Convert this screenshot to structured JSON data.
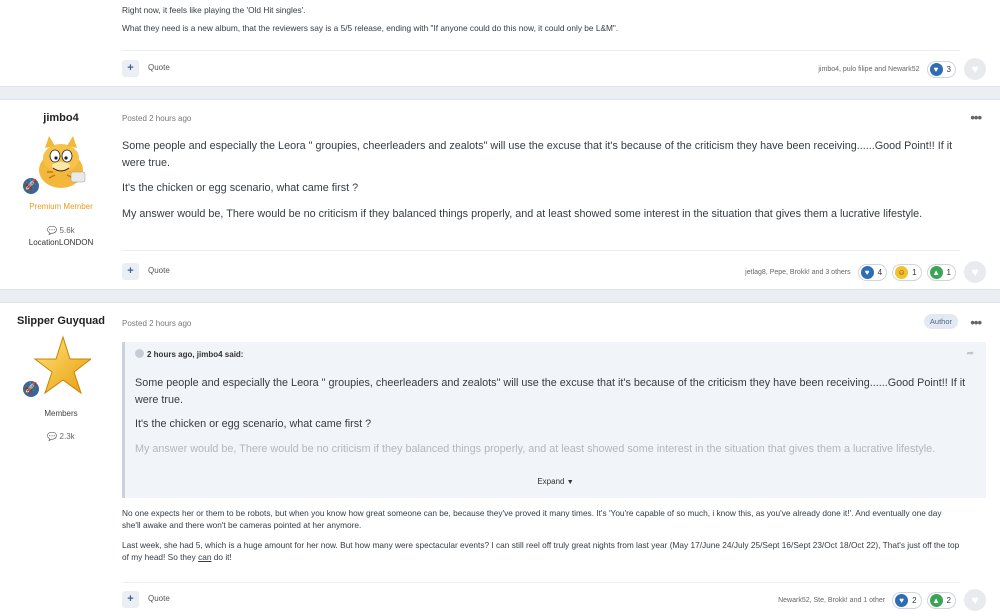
{
  "post1": {
    "lines": [
      "Right now, it feels like playing the 'Old Hit singles'.",
      "What they need is a new album, that the reviewers say is a 5/5 release, ending with \"If anyone could do this now, it could only be L&M\"."
    ],
    "quote_label": "Quote",
    "reaction_names": "jimbo4, pulo filipe and Newark52",
    "reactions": [
      {
        "icon": "heart-icon",
        "count": "3"
      }
    ]
  },
  "post2": {
    "author": "jimbo4",
    "title": "Premium Member",
    "post_count": "5.6k",
    "location": "LocationLONDON",
    "posted": "Posted 2 hours ago",
    "paragraphs": [
      "Some people and especially the Leora \" groupies, cheerleaders and zealots\" will use the excuse that it's because of the criticism they have been receiving......Good Point!! If it were true.",
      "It's the chicken or egg scenario, what came first ?",
      "My answer would be, There would be no criticism if they balanced things properly, and at least showed some interest in the situation that gives them a lucrative lifestyle."
    ],
    "quote_label": "Quote",
    "reaction_names": "jetlag8, Pepe, Brokk! and 3 others",
    "reactions": [
      {
        "icon": "heart-icon",
        "count": "4"
      },
      {
        "icon": "laughing-face-icon",
        "count": "1"
      },
      {
        "icon": "thumbs-up-icon",
        "count": "1"
      }
    ]
  },
  "post3": {
    "author": "Slipper Guyquad",
    "title": "Members",
    "post_count": "2.3k",
    "posted": "Posted 2 hours ago",
    "author_tag": "Author",
    "quote": {
      "header": "2 hours ago, jimbo4 said:",
      "paragraphs": [
        "Some people and especially the Leora \" groupies, cheerleaders and zealots\" will use the excuse that it's because of the criticism they have been receiving......Good Point!! If it were true.",
        "It's the chicken or egg scenario, what came first ?",
        "My answer would be, There would be no criticism if they balanced things properly, and at least showed some interest in the situation that gives them a lucrative lifestyle."
      ],
      "expand_label": "Expand"
    },
    "paragraph1": "No one expects her or them to be robots, but when you know how great someone can be, because they've proved it many times. It's 'You're capable of so much, i know this, as you've already done it!'. And eventually one day she'll awake and there won't be cameras pointed at her anymore.",
    "paragraph2_before": "Last week, she had 5, which is a huge amount for her now. But how many were spectacular events? I can still reel off truly great nights from last year (May 17/June 24/July 25/Sept 16/Sept 23/Oct 18/Oct 22), That's just off the top of my head! So they ",
    "paragraph2_underlined": "can",
    "paragraph2_after": " do it!",
    "quote_label": "Quote",
    "reaction_names": "Newark52, Ste, Brokk! and 1 other",
    "reactions": [
      {
        "icon": "heart-icon",
        "count": "2"
      },
      {
        "icon": "thumbs-up-icon",
        "count": "2"
      }
    ]
  }
}
